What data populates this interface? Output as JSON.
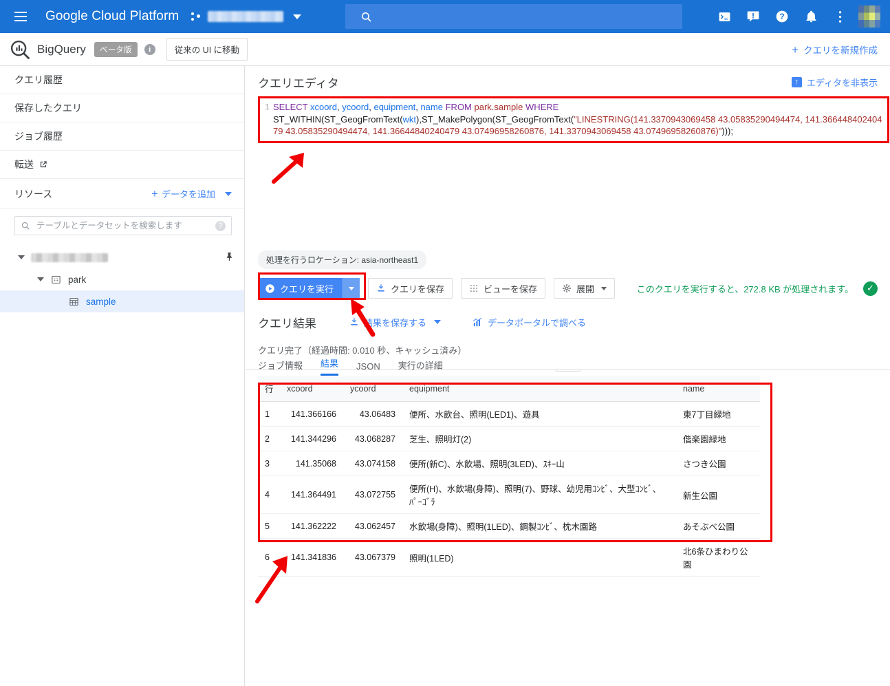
{
  "header": {
    "product": "Google Cloud Platform",
    "project_redacted": "",
    "search_placeholder": "",
    "icons": [
      "cloud-shell-icon",
      "feedback-icon",
      "help-icon",
      "notifications-icon",
      "more-vert-icon",
      "avatar"
    ]
  },
  "bq_bar": {
    "title": "BigQuery",
    "beta_chip": "ベータ版",
    "info": "i",
    "legacy_button": "従来の UI に移動",
    "new_query": "クエリを新規作成",
    "new_query_icon": "plus-icon"
  },
  "sidebar": {
    "nav": [
      {
        "label": "クエリ履歴"
      },
      {
        "label": "保存したクエリ"
      },
      {
        "label": "ジョブ履歴"
      },
      {
        "label": "転送",
        "external": true
      }
    ],
    "resources_title": "リソース",
    "add_data": "データを追加",
    "search_placeholder": "テーブルとデータセットを検索します",
    "help_glyph": "?",
    "tree": {
      "project_redacted": "",
      "dataset": "park",
      "table": "sample"
    }
  },
  "editor": {
    "title": "クエリエディタ",
    "hide_editor": "エディタを非表示",
    "line_number": "1",
    "sql_tokens": [
      {
        "t": "SELECT",
        "c": "kw"
      },
      {
        "t": " ",
        "c": "pn"
      },
      {
        "t": "xcoord",
        "c": "id"
      },
      {
        "t": ", ",
        "c": "pn"
      },
      {
        "t": "ycoord",
        "c": "id"
      },
      {
        "t": ", ",
        "c": "pn"
      },
      {
        "t": "equipment",
        "c": "id"
      },
      {
        "t": ", ",
        "c": "pn"
      },
      {
        "t": "name",
        "c": "id"
      },
      {
        "t": " ",
        "c": "pn"
      },
      {
        "t": "FROM",
        "c": "kw"
      },
      {
        "t": " ",
        "c": "pn"
      },
      {
        "t": "park.sample",
        "c": "tbl"
      },
      {
        "t": " ",
        "c": "pn"
      },
      {
        "t": "WHERE",
        "c": "kw"
      },
      {
        "t": "\n",
        "c": "pn"
      },
      {
        "t": "ST_WITHIN(ST_GeogFromText(",
        "c": "fn"
      },
      {
        "t": "wkt",
        "c": "id"
      },
      {
        "t": "),ST_MakePolygon(ST_GeogFromText(",
        "c": "fn"
      },
      {
        "t": "\"LINESTRING(141.3370943069458 43.05835290494474, 141.36644840240479 43.05835290494474, 141.36644840240479 43.07496958260876, 141.3370943069458 43.07496958260876)\"",
        "c": "str"
      },
      {
        "t": ")));",
        "c": "fn"
      }
    ],
    "sql_plain": "SELECT xcoord, ycoord, equipment, name FROM park.sample WHERE\nST_WITHIN(ST_GeogFromText(wkt),ST_MakePolygon(ST_GeogFromText(\"LINESTRING(141.3370943069458 43.05835290494474, 141.36644840240479 43.05835290494474, 141.36644840240479 43.07496958260876, 141.3370943069458 43.07496958260876)\")));"
  },
  "toolbar": {
    "location_badge": "処理を行うロケーション: asia-northeast1",
    "run_query": "クエリを実行",
    "save_query": "クエリを保存",
    "save_view": "ビューを保存",
    "expand": "展開",
    "cost_text": "このクエリを実行すると、272.8 KB が処理されます。",
    "cost_color": "#0f9d58",
    "check_icon": "check-circle-icon"
  },
  "results": {
    "title": "クエリ結果",
    "save_results": "結果を保存する",
    "explore_datastudio": "データポータルで調べる",
    "complete_text": "クエリ完了（経過時間: 0.010 秒、キャッシュ済み）",
    "tabs": [
      {
        "label": "ジョブ情報",
        "active": false
      },
      {
        "label": "結果",
        "active": true
      },
      {
        "label": "JSON",
        "active": false
      },
      {
        "label": "実行の詳細",
        "active": false
      }
    ],
    "columns": [
      "行",
      "xcoord",
      "ycoord",
      "equipment",
      "name"
    ],
    "rows": [
      {
        "row": "1",
        "xcoord": "141.366166",
        "ycoord": "43.06483",
        "equipment": "便所、水飲台、照明(LED1)、遊具",
        "name": "東7丁目緑地"
      },
      {
        "row": "2",
        "xcoord": "141.344296",
        "ycoord": "43.068287",
        "equipment": "芝生、照明灯(2)",
        "name": "偕楽園緑地"
      },
      {
        "row": "3",
        "xcoord": "141.35068",
        "ycoord": "43.074158",
        "equipment": "便所(新C)、水飲場、照明(3LED)、ｽｷｰ山",
        "name": "さつき公園"
      },
      {
        "row": "4",
        "xcoord": "141.364491",
        "ycoord": "43.072755",
        "equipment": "便所(H)、水飲場(身障)、照明(7)、野球、幼児用ｺﾝﾋﾞ、大型ｺﾝﾋﾞ、ﾊﾟｰｺﾞﾗ",
        "name": "新生公園"
      },
      {
        "row": "5",
        "xcoord": "141.362222",
        "ycoord": "43.062457",
        "equipment": "水飲場(身障)、照明(1LED)、鋼製ｺﾝﾋﾞ、枕木園路",
        "name": "あそぶべ公園"
      },
      {
        "row": "6",
        "xcoord": "141.341836",
        "ycoord": "43.067379",
        "equipment": "照明(1LED)",
        "name": "北6条ひまわり公園"
      }
    ]
  },
  "annotations": {
    "highlight_color": "#f00000",
    "boxes": [
      "query-editor-box",
      "run-query-box",
      "results-table-box"
    ],
    "arrows": [
      "arrow-to-editor",
      "arrow-to-run-button",
      "arrow-to-results-table"
    ]
  }
}
